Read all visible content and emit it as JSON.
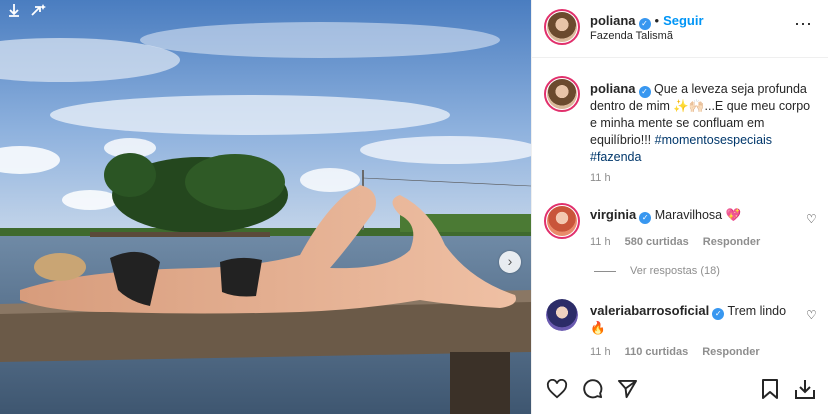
{
  "post": {
    "author": "poliana",
    "follow_label": "Seguir",
    "location": "Fazenda Talismã",
    "separator": "•",
    "caption_text": "Que a leveza seja profunda dentro de mim ✨🙌🏻...E que meu corpo e minha mente se confluam em equilíbrio!!!",
    "hashtag_1": "#momentosespeciais",
    "hashtag_2": "#fazenda",
    "caption_time": "11 h"
  },
  "comments": [
    {
      "author": "virginia",
      "text": "Maravilhosa 💖",
      "time": "11 h",
      "likes": "580 curtidas",
      "reply_label": "Responder",
      "view_replies": "Ver respostas (18)"
    },
    {
      "author": "valeriabarrosoficial",
      "text": "Trem lindo 🔥",
      "time": "11 h",
      "likes": "110 curtidas",
      "reply_label": "Responder"
    }
  ],
  "icons": {
    "more": "⋯",
    "verified": "✓",
    "next": "›",
    "small_heart": "♡"
  },
  "colors": {
    "accent": "#0095f6",
    "verified": "#3897f0",
    "hashtag": "#00376b",
    "muted": "#8e8e8e"
  }
}
